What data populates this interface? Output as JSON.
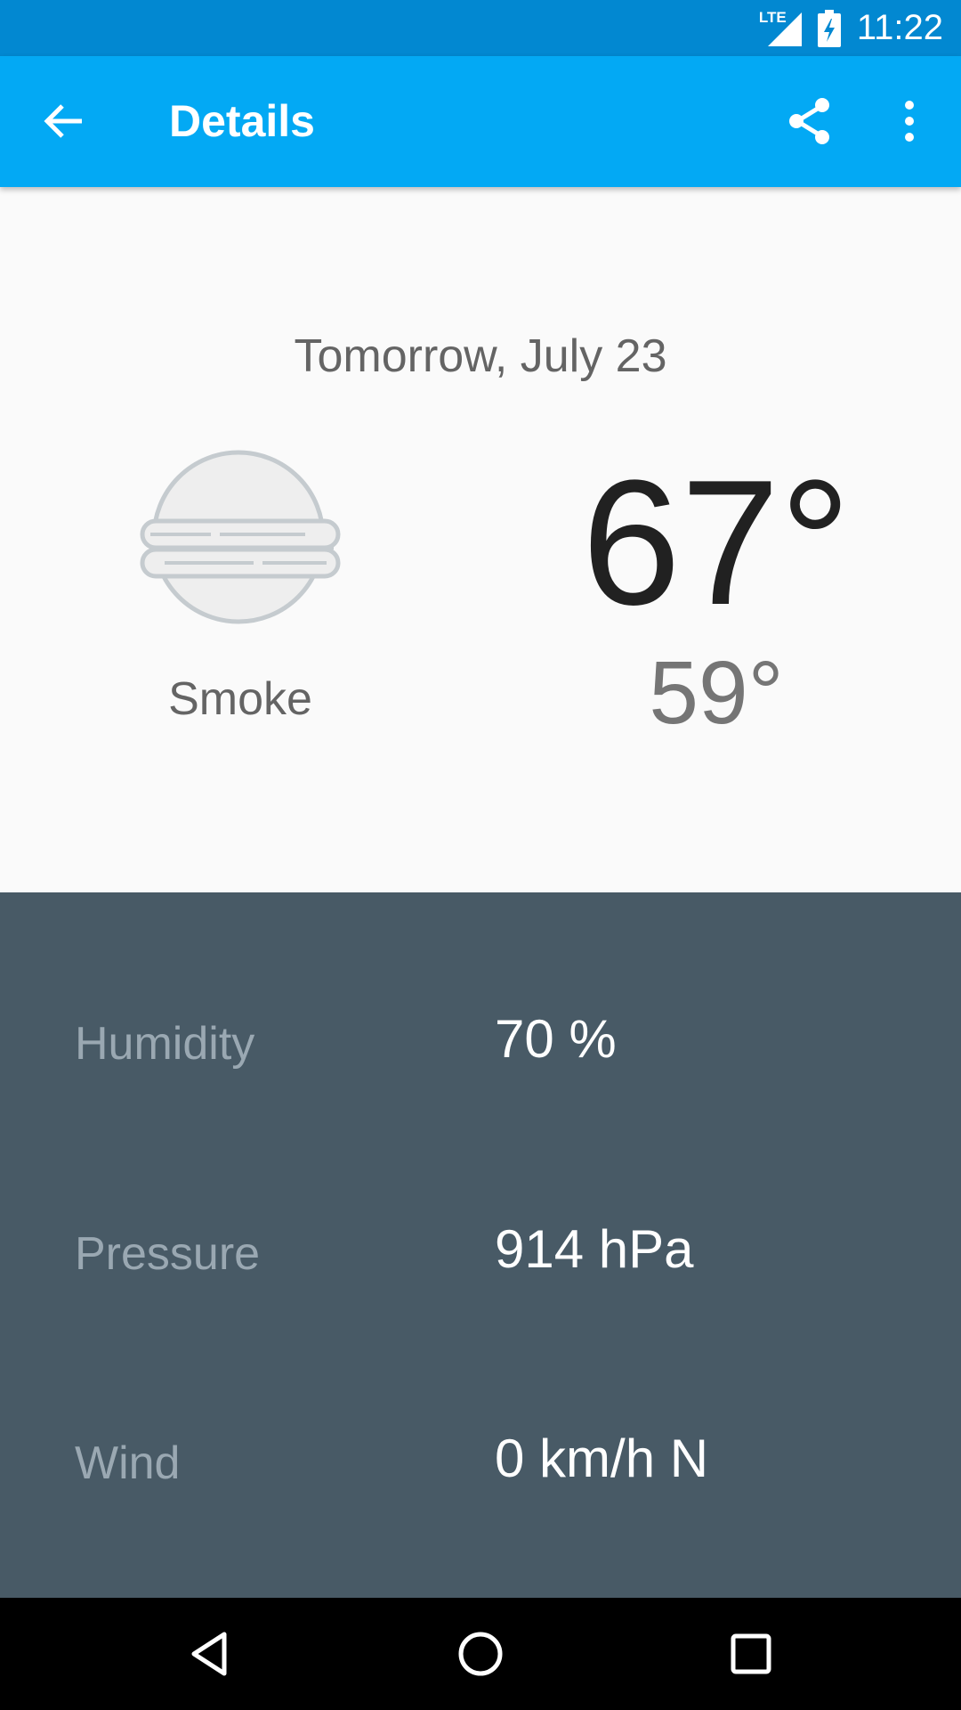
{
  "status_bar": {
    "network_label": "LTE",
    "time": "11:22",
    "icons": [
      "lte-signal-icon",
      "battery-charging-icon"
    ]
  },
  "app_bar": {
    "title": "Details",
    "icons": [
      "arrow-back-icon",
      "share-icon",
      "more-vert-icon"
    ]
  },
  "forecast": {
    "date": "Tomorrow, July 23",
    "condition": "Smoke",
    "condition_icon": "fog-icon",
    "high": "67°",
    "low": "59°"
  },
  "details": {
    "rows": [
      {
        "label": "Humidity",
        "value": "70 %"
      },
      {
        "label": "Pressure",
        "value": "914 hPa"
      },
      {
        "label": "Wind",
        "value": "0 km/h N"
      }
    ]
  },
  "nav_bar": {
    "icons": [
      "back-triangle-icon",
      "home-circle-icon",
      "recents-square-icon"
    ]
  },
  "colors": {
    "status_bar": "#0288d1",
    "app_bar": "#03a9f4",
    "details_bg": "#485a66",
    "detail_label": "#9aa8b2"
  }
}
